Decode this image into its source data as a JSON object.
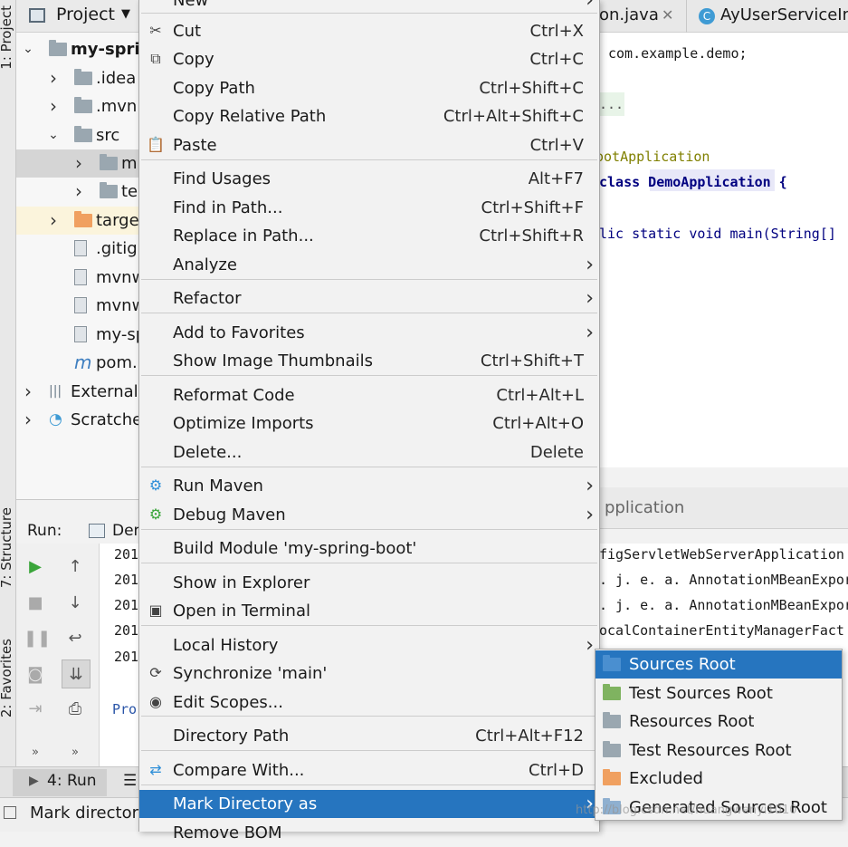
{
  "left_strip": {
    "project_tab": "1: Project",
    "structure_tab": "7: Structure",
    "favorites_tab": "2: Favorites"
  },
  "project": {
    "title": "Project",
    "tree": [
      {
        "label": "my-sprin",
        "level": 0,
        "arrow": "down",
        "icon": "module"
      },
      {
        "label": ".idea",
        "level": 1,
        "arrow": "right",
        "icon": "folder"
      },
      {
        "label": ".mvn",
        "level": 1,
        "arrow": "right",
        "icon": "folder"
      },
      {
        "label": "src",
        "level": 1,
        "arrow": "down",
        "icon": "folder"
      },
      {
        "label": "m",
        "level": 2,
        "arrow": "right",
        "icon": "folder"
      },
      {
        "label": "te",
        "level": 2,
        "arrow": "right",
        "icon": "folder"
      },
      {
        "label": "targe",
        "level": 1,
        "arrow": "right",
        "icon": "folder-orange"
      },
      {
        "label": ".gitig",
        "level": 1,
        "arrow": "",
        "icon": "file"
      },
      {
        "label": "mvnw",
        "level": 1,
        "arrow": "",
        "icon": "file"
      },
      {
        "label": "mvnw",
        "level": 1,
        "arrow": "",
        "icon": "file"
      },
      {
        "label": "my-sp",
        "level": 1,
        "arrow": "",
        "icon": "file"
      },
      {
        "label": "pom.",
        "level": 1,
        "arrow": "",
        "icon": "maven"
      },
      {
        "label": "External",
        "level": 0,
        "arrow": "right",
        "icon": "library"
      },
      {
        "label": "Scratches",
        "level": 0,
        "arrow": "right",
        "icon": "scratch"
      }
    ]
  },
  "editor": {
    "tabs": [
      "on.java",
      "AyUserServiceIm"
    ],
    "lines": [
      "com.example.demo;",
      "...",
      "ootApplication",
      "class DemoApplication {",
      "lic static void main(String[]"
    ]
  },
  "run": {
    "label": "Run:",
    "config": "Dem",
    "panel_title": "pplication",
    "log_prefix": [
      "201",
      "201",
      "201",
      "201",
      "201"
    ],
    "log_right": [
      "figServletWebServerApplication",
      ". j. e. a. AnnotationMBeanExporter",
      ". j. e. a. AnnotationMBeanExporter",
      "ocalContainerEntityManagerFact",
      ""
    ],
    "process_text": "Pro"
  },
  "bottom": {
    "run_tab": "4: Run",
    "status": "Mark directory"
  },
  "menu": {
    "items": [
      {
        "label": "New",
        "shortcut": "",
        "sub": true,
        "icon": ""
      },
      {
        "label": "Cut",
        "shortcut": "Ctrl+X",
        "icon": "✂"
      },
      {
        "label": "Copy",
        "shortcut": "Ctrl+C",
        "icon": "⧉"
      },
      {
        "label": "Copy Path",
        "shortcut": "Ctrl+Shift+C",
        "icon": ""
      },
      {
        "label": "Copy Relative Path",
        "shortcut": "Ctrl+Alt+Shift+C",
        "icon": ""
      },
      {
        "label": "Paste",
        "shortcut": "Ctrl+V",
        "icon": "📋"
      },
      {
        "label": "Find Usages",
        "shortcut": "Alt+F7",
        "icon": ""
      },
      {
        "label": "Find in Path...",
        "shortcut": "Ctrl+Shift+F",
        "icon": ""
      },
      {
        "label": "Replace in Path...",
        "shortcut": "Ctrl+Shift+R",
        "icon": ""
      },
      {
        "label": "Analyze",
        "shortcut": "",
        "sub": true,
        "icon": ""
      },
      {
        "label": "Refactor",
        "shortcut": "",
        "sub": true,
        "icon": ""
      },
      {
        "label": "Add to Favorites",
        "shortcut": "",
        "sub": true,
        "icon": ""
      },
      {
        "label": "Show Image Thumbnails",
        "shortcut": "Ctrl+Shift+T",
        "icon": ""
      },
      {
        "label": "Reformat Code",
        "shortcut": "Ctrl+Alt+L",
        "icon": ""
      },
      {
        "label": "Optimize Imports",
        "shortcut": "Ctrl+Alt+O",
        "icon": ""
      },
      {
        "label": "Delete...",
        "shortcut": "Delete",
        "icon": ""
      },
      {
        "label": "Run Maven",
        "shortcut": "",
        "sub": true,
        "icon": "⚙"
      },
      {
        "label": "Debug Maven",
        "shortcut": "",
        "sub": true,
        "icon": "⚙"
      },
      {
        "label": "Build Module 'my-spring-boot'",
        "shortcut": "",
        "icon": ""
      },
      {
        "label": "Show in Explorer",
        "shortcut": "",
        "icon": ""
      },
      {
        "label": "Open in Terminal",
        "shortcut": "",
        "icon": "▣"
      },
      {
        "label": "Local History",
        "shortcut": "",
        "sub": true,
        "icon": ""
      },
      {
        "label": "Synchronize 'main'",
        "shortcut": "",
        "icon": "⟳"
      },
      {
        "label": "Edit Scopes...",
        "shortcut": "",
        "icon": "◉"
      },
      {
        "label": "Directory Path",
        "shortcut": "Ctrl+Alt+F12",
        "icon": ""
      },
      {
        "label": "Compare With...",
        "shortcut": "Ctrl+D",
        "icon": "⇄"
      },
      {
        "label": "Mark Directory as",
        "shortcut": "",
        "sub": true,
        "icon": "",
        "active": true
      },
      {
        "label": "Remove BOM",
        "shortcut": "",
        "icon": ""
      }
    ]
  },
  "submenu": {
    "items": [
      {
        "label": "Sources Root",
        "color": "#4a8fd0",
        "active": true
      },
      {
        "label": "Test Sources Root",
        "color": "#7fb360"
      },
      {
        "label": "Resources Root",
        "color": "#9aa7b0"
      },
      {
        "label": "Test Resources Root",
        "color": "#9aa7b0"
      },
      {
        "label": "Excluded",
        "color": "#f0a060"
      },
      {
        "label": "Generated Sources Root",
        "color": "#8fb0d0"
      }
    ]
  },
  "watermark": "http://blog.csdn.net/huangwenyi1010"
}
